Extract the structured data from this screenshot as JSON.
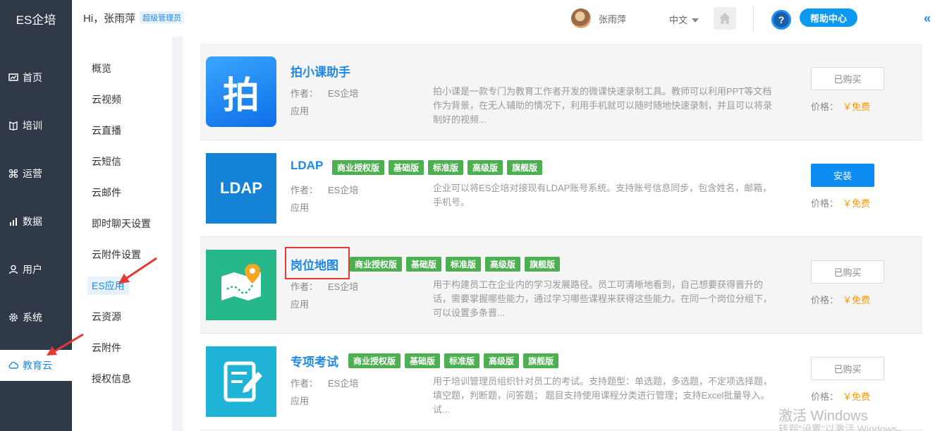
{
  "header": {
    "logo": "ES企培",
    "greeting": "Hi，张雨萍",
    "role_badge": "超级管理员",
    "user_name": "张雨萍",
    "language": "中文",
    "help_center": "帮助中心",
    "help_icon_text": "?",
    "collapse_icon": "«"
  },
  "sidebar": {
    "items": [
      {
        "label": "首页",
        "icon": "dashboard-icon"
      },
      {
        "label": "培训",
        "icon": "book-icon"
      },
      {
        "label": "运营",
        "icon": "command-icon"
      },
      {
        "label": "数据",
        "icon": "chart-icon"
      },
      {
        "label": "用户",
        "icon": "user-icon"
      },
      {
        "label": "系统",
        "icon": "gear-icon"
      },
      {
        "label": "教育云",
        "icon": "cloud-icon",
        "active": true
      }
    ]
  },
  "submenu": {
    "items": [
      {
        "label": "概览"
      },
      {
        "label": "云视频"
      },
      {
        "label": "云直播"
      },
      {
        "label": "云短信"
      },
      {
        "label": "云邮件"
      },
      {
        "label": "即时聊天设置"
      },
      {
        "label": "云附件设置"
      },
      {
        "label": "ES应用",
        "active": true
      },
      {
        "label": "云资源"
      },
      {
        "label": "云附件"
      },
      {
        "label": "授权信息"
      }
    ]
  },
  "labels": {
    "author": "作者：",
    "price": "价格：",
    "free": "￥免费"
  },
  "apps": [
    {
      "title": "拍小课助手",
      "author": "ES企培",
      "type": "应用",
      "description": "拍小课是一款专门为教育工作者开发的微课快速录制工具。教师可以利用PPT等文档作为背景，在无人辅助的情况下，利用手机就可以随时随地快速录制，并且可以将录制好的视频...",
      "tags": [],
      "action": "已购买",
      "icon_text": "拍"
    },
    {
      "title": "LDAP",
      "author": "ES企培",
      "type": "应用",
      "description": "企业可以将ES企培对接现有LDAP账号系统。支持账号信息同步，包含姓名，邮箱，手机号。",
      "tags": [
        "商业授权版",
        "基础版",
        "标准版",
        "高级版",
        "旗舰版"
      ],
      "action": "安装",
      "icon_text": "LDAP"
    },
    {
      "title": "岗位地图",
      "author": "ES企培",
      "type": "应用",
      "description": "用于构建员工在企业内的学习发展路径。员工可清晰地看到，自己想要获得晋升的话，需要掌握哪些能力，通过学习哪些课程来获得这些能力。在同一个岗位分组下，可以设置多条晋...",
      "tags": [
        "商业授权版",
        "基础版",
        "标准版",
        "高级版",
        "旗舰版"
      ],
      "action": "已购买"
    },
    {
      "title": "专项考试",
      "author": "ES企培",
      "type": "应用",
      "description": "用于培训管理员组织针对员工的考试。支持题型：单选题，多选题，不定项选择题，填空题，判断题，问答题； 题目支持使用课程分类进行管理；支持Excel批量导入。 试...",
      "tags": [
        "商业授权版",
        "基础版",
        "标准版",
        "高级版",
        "旗舰版"
      ],
      "action": "已购买"
    }
  ],
  "watermark": {
    "line1": "激活 Windows",
    "line2": "转到\"设置\"以激活 Windows。"
  },
  "colors": {
    "sidebar_bg": "#2f3947",
    "accent": "#1e88e5",
    "tag_green": "#4caf50",
    "price_orange": "#ff9800",
    "install_blue": "#0d8df2"
  }
}
